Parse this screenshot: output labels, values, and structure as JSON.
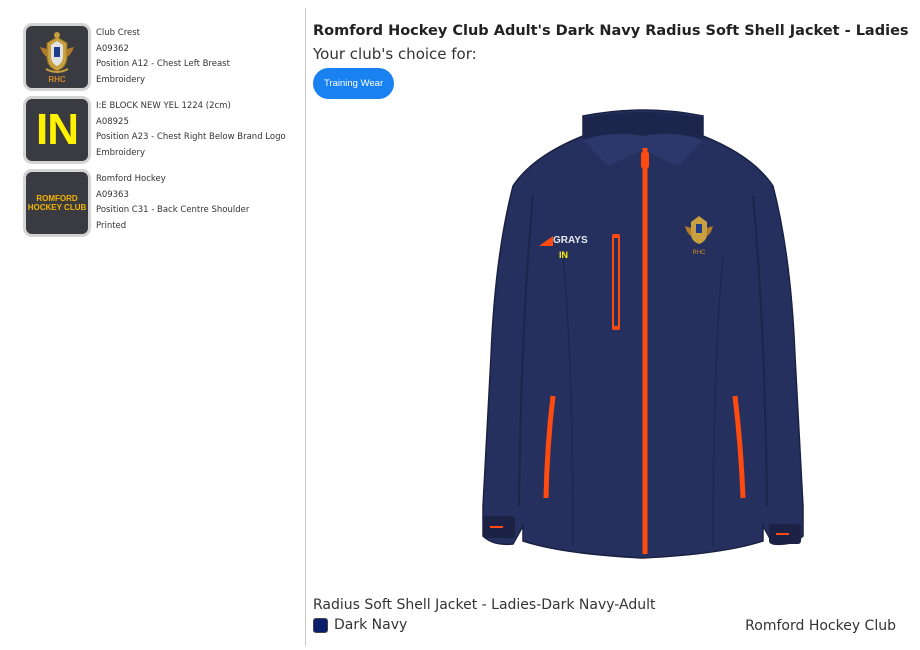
{
  "logos": [
    {
      "name": "Club Crest",
      "code": "A09362",
      "position": "Position A12 - Chest Left Breast",
      "method": "Embroidery",
      "thumb_text": "RHC"
    },
    {
      "name": "I:E BLOCK NEW YEL 1224 (2cm)",
      "code": "A08925",
      "position": "Position A23 - Chest Right Below Brand Logo",
      "method": "Embroidery",
      "thumb_text": "IN"
    },
    {
      "name": "Romford Hockey",
      "code": "A09363",
      "position": "Position C31 - Back Centre Shoulder",
      "method": "Printed",
      "thumb_text_line1": "ROMFORD",
      "thumb_text_line2": "HOCKEY CLUB"
    }
  ],
  "product": {
    "title": "Romford Hockey Club Adult's Dark Navy Radius Soft Shell Jacket - Ladies",
    "choice_label": "Your club's choice for:",
    "tag_label": "Training Wear",
    "variant_name": "Radius Soft Shell Jacket - Ladies-Dark Navy-Adult",
    "colour_name": "Dark Navy",
    "colour_hex": "#0b1e6b",
    "club_name": "Romford Hockey Club",
    "jacket_brand_text": "GRAYS",
    "jacket_chest_text": "IN",
    "jacket_crest_text": "RHC"
  },
  "colors": {
    "jacket_navy": "#25305e",
    "zip_orange": "#ff4a10",
    "accent_blue": "#1a82f0",
    "logo_yellow": "#fff200"
  }
}
